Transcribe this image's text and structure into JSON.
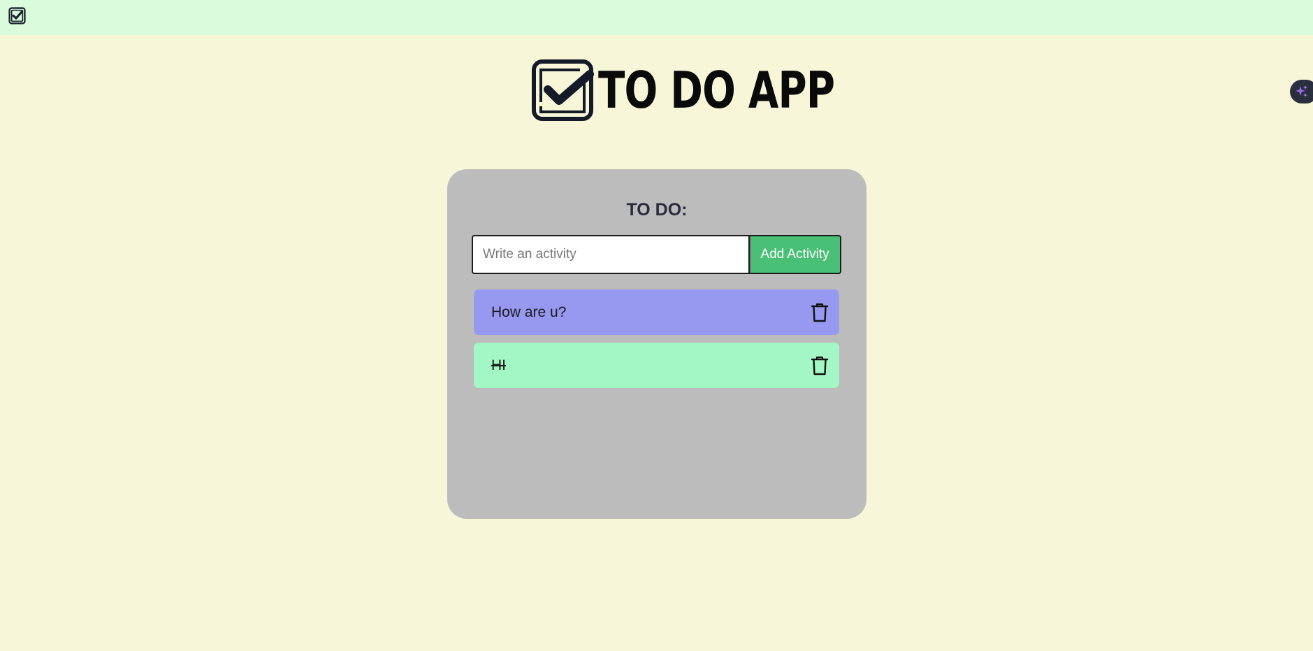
{
  "brand": {
    "title": "TO DO APP",
    "logo_icon": "checkbox-checked-icon"
  },
  "topbar": {
    "favicon_icon": "checkbox-checked-icon",
    "color": "#dafcdc"
  },
  "extension": {
    "icon": "sparkles-icon"
  },
  "card": {
    "heading": "TO DO:",
    "input": {
      "placeholder": "Write an activity",
      "value": ""
    },
    "add_button_label": "Add Activity",
    "add_button_color": "#4ac077"
  },
  "todos": [
    {
      "text": "How are u?",
      "completed": false,
      "color": "#9798f0",
      "delete_icon": "trash-icon"
    },
    {
      "text": "HI",
      "completed": true,
      "color": "#a3f7c5",
      "delete_icon": "trash-icon"
    }
  ],
  "colors": {
    "background": "#f7f6d9",
    "card": "#bcbcbc"
  }
}
